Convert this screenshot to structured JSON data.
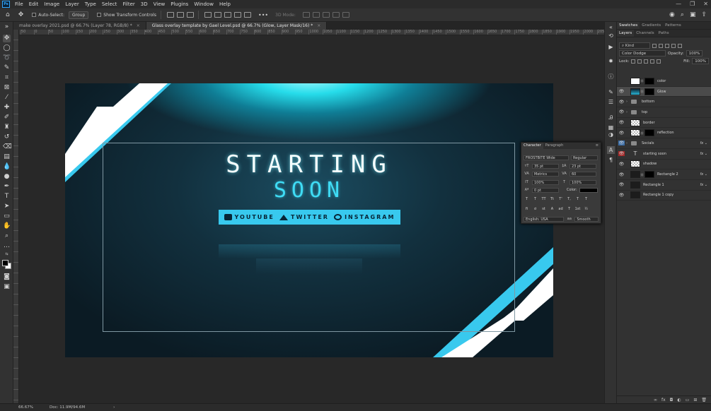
{
  "app": {
    "logo_text": "Ps"
  },
  "menu": [
    "File",
    "Edit",
    "Image",
    "Layer",
    "Type",
    "Select",
    "Filter",
    "3D",
    "View",
    "Plugins",
    "Window",
    "Help"
  ],
  "window_controls": {
    "minimize": "—",
    "restore": "❐",
    "close": "✕"
  },
  "options_bar": {
    "auto_select_label": "Auto-Select:",
    "group_value": "Group",
    "transform_label": "Show Transform Controls",
    "more": "•••",
    "mode_3d": "3D Mode:"
  },
  "tabs": [
    {
      "title": "make overlay 2021.psd @ 66.7% (Layer 78, RGB/8) *",
      "close": "×"
    },
    {
      "title": "Glass overlay template by Gael Level.psd @ 66.7% (Glow, Layer Mask/16) *",
      "close": "×"
    }
  ],
  "ruler_ticks": [
    "50",
    "0",
    "50",
    "100",
    "150",
    "200",
    "250",
    "300",
    "350",
    "400",
    "450",
    "500",
    "550",
    "600",
    "650",
    "700",
    "750",
    "800",
    "850",
    "900",
    "950",
    "1000",
    "1050",
    "1100",
    "1150",
    "1200",
    "1250",
    "1300",
    "1350",
    "1400",
    "1450",
    "1500",
    "1550",
    "1600",
    "1650",
    "1700",
    "1750",
    "1800",
    "1850",
    "1900",
    "1950",
    "2000",
    "2050"
  ],
  "artboard": {
    "title_line1": "STARTING",
    "title_line2": "SOON",
    "socials": [
      "YOUTUBE",
      "TWITTER",
      "INSTAGRAM"
    ],
    "colors": {
      "accent": "#38c9ee",
      "white": "#ffffff",
      "bg_dark": "#0b1b24"
    }
  },
  "character_panel": {
    "tabs": [
      "Character",
      "Paragraph"
    ],
    "font_family": "FROSTBITE Wide",
    "font_style": "Regular",
    "font_size": "35 pt",
    "leading": "23 pt",
    "kerning": "Metrics",
    "tracking": "60",
    "vertical_scale": "100%",
    "horizontal_scale": "100%",
    "baseline_shift": "0 pt",
    "color_label": "Color:",
    "language": "English: USA",
    "aa_icon": "aa",
    "antialias": "Smooth",
    "style_buttons": [
      "T",
      "T",
      "TT",
      "Tt",
      "T'",
      "T,",
      "T",
      "T"
    ],
    "opentype_buttons": [
      "fi",
      "ơ",
      "st",
      "A",
      "ad",
      "T",
      "1st",
      "½"
    ]
  },
  "layers_panel": {
    "top_tabs": [
      "Swatches",
      "Gradients",
      "Patterns"
    ],
    "tabs": [
      "Layers",
      "Channels",
      "Paths"
    ],
    "kind_label": "Kind",
    "blend_mode": "Color Dodge",
    "opacity_label": "Opacity:",
    "opacity_value": "100%",
    "lock_label": "Lock:",
    "fill_label": "Fill:",
    "fill_value": "100%",
    "layers": [
      {
        "name": "color",
        "eye": "",
        "thumb": "white",
        "mask": true,
        "fx": false,
        "folder": false
      },
      {
        "name": "Glow",
        "eye": "👁",
        "thumb": "glow",
        "mask": true,
        "fx": false,
        "folder": false,
        "selected": true
      },
      {
        "name": "bottom",
        "eye": "👁",
        "thumb": "",
        "mask": false,
        "fx": false,
        "folder": true
      },
      {
        "name": "top",
        "eye": "👁",
        "thumb": "",
        "mask": false,
        "fx": false,
        "folder": true
      },
      {
        "name": "border",
        "eye": "👁",
        "thumb": "checker",
        "mask": false,
        "fx": false,
        "folder": false
      },
      {
        "name": "reflection",
        "eye": "👁",
        "thumb": "checker",
        "mask": true,
        "fx": false,
        "folder": false
      },
      {
        "name": "Socials",
        "eye": "👁",
        "thumb": "",
        "mask": false,
        "fx": true,
        "folder": true,
        "eye_color": "blue"
      },
      {
        "name": "starting soon",
        "eye": "👁",
        "thumb": "text",
        "mask": false,
        "fx": true,
        "folder": false,
        "eye_color": "red"
      },
      {
        "name": "shadow",
        "eye": "👁",
        "thumb": "checker",
        "mask": false,
        "fx": false,
        "folder": false
      },
      {
        "name": "Rectangle 2",
        "eye": "👁",
        "thumb": "dark",
        "mask": true,
        "fx": true,
        "folder": false
      },
      {
        "name": "Rectangle 1",
        "eye": "👁",
        "thumb": "dark",
        "mask": false,
        "fx": true,
        "folder": false
      },
      {
        "name": "Rectangle 1 copy",
        "eye": "👁",
        "thumb": "dark",
        "mask": false,
        "fx": false,
        "folder": false
      }
    ],
    "bottom_icons": [
      "∞",
      "fx",
      "◘",
      "◐",
      "▭",
      "⊞",
      "🗑"
    ]
  },
  "status": {
    "zoom": "66.67%",
    "doc": "Doc: 11.9M/94.6M",
    "arrow": "›"
  }
}
